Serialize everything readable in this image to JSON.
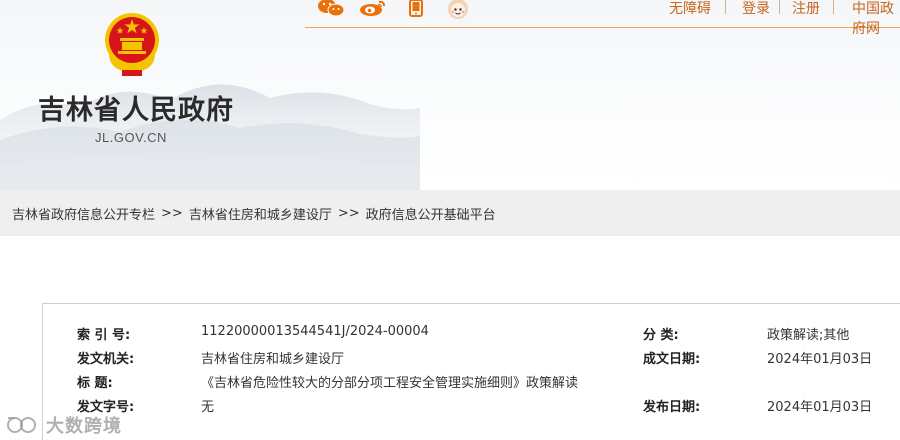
{
  "site": {
    "title": "吉林省人民政府",
    "domain": "JL.GOV.CN"
  },
  "social_icons": [
    "wechat-icon",
    "weibo-icon",
    "mobile-icon",
    "robot-assistant-icon"
  ],
  "top_links": {
    "accessibility": "无障碍",
    "login": "登录",
    "register": "注册",
    "china_gov": "中国政府网"
  },
  "breadcrumb": {
    "items": [
      "吉林省政府信息公开专栏",
      "吉林省住房和城乡建设厅",
      "政府信息公开基础平台"
    ],
    "separator": ">>"
  },
  "info": {
    "index_label": "索 引 号:",
    "index_value": "11220000013544541J/2024-00004",
    "category_label": "分    类:",
    "category_value": "政策解读;其他",
    "issuer_label": "发文机关:",
    "issuer_value": "吉林省住房和城乡建设厅",
    "created_label": "成文日期:",
    "created_value": "2024年01月03日",
    "title_label": "标    题:",
    "title_value": "《吉林省危险性较大的分部分项工程安全管理实施细则》政策解读",
    "docno_label": "发文字号:",
    "docno_value": "无",
    "published_label": "发布日期:",
    "published_value": "2024年01月03日"
  },
  "watermark": {
    "text": "大数跨境"
  },
  "colors": {
    "accent": "#c9661f",
    "emblem_red": "#d7141a",
    "emblem_gold": "#f5c400"
  }
}
